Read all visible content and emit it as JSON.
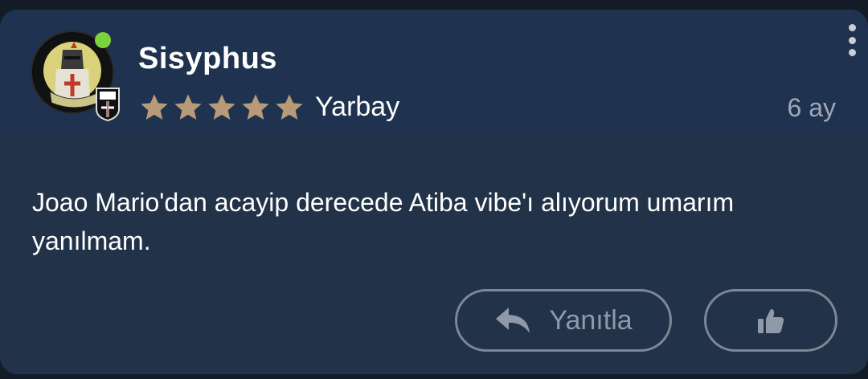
{
  "comment": {
    "author": {
      "username": "Sisyphus",
      "rank": "Yarbay",
      "stars": 5,
      "online": true,
      "avatar_icon": "knight-avatar-icon",
      "badge_icon": "besiktas-crest-icon"
    },
    "time_ago": "6 ay",
    "text": "Joao Mario'dan acayip derecede Atiba vibe'ı alıyorum umarım yanılmam.",
    "actions": {
      "reply_label": "Yanıtla",
      "reply_icon": "reply-arrow-icon",
      "like_icon": "thumbs-up-icon"
    },
    "menu_icon": "more-vertical-icon"
  },
  "colors": {
    "background": "#131b26",
    "header": "#1f3350",
    "body": "#223248",
    "star": "#b89a78",
    "online": "#7ed23a",
    "muted": "#9fa9b6"
  }
}
